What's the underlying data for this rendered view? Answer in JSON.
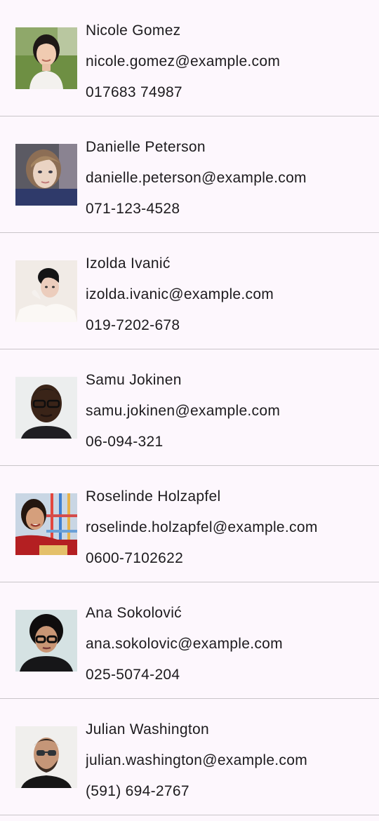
{
  "contacts": [
    {
      "name": "Nicole Gomez",
      "email": "nicole.gomez@example.com",
      "phone": "017683 74987"
    },
    {
      "name": "Danielle Peterson",
      "email": "danielle.peterson@example.com",
      "phone": "071-123-4528"
    },
    {
      "name": "Izolda Ivanić",
      "email": "izolda.ivanic@example.com",
      "phone": "019-7202-678"
    },
    {
      "name": "Samu Jokinen",
      "email": "samu.jokinen@example.com",
      "phone": "06-094-321"
    },
    {
      "name": "Roselinde Holzapfel",
      "email": "roselinde.holzapfel@example.com",
      "phone": "0600-7102622"
    },
    {
      "name": "Ana Sokolović",
      "email": "ana.sokolovic@example.com",
      "phone": "025-5074-204"
    },
    {
      "name": "Julian Washington",
      "email": "julian.washington@example.com",
      "phone": "(591) 694-2767"
    }
  ]
}
